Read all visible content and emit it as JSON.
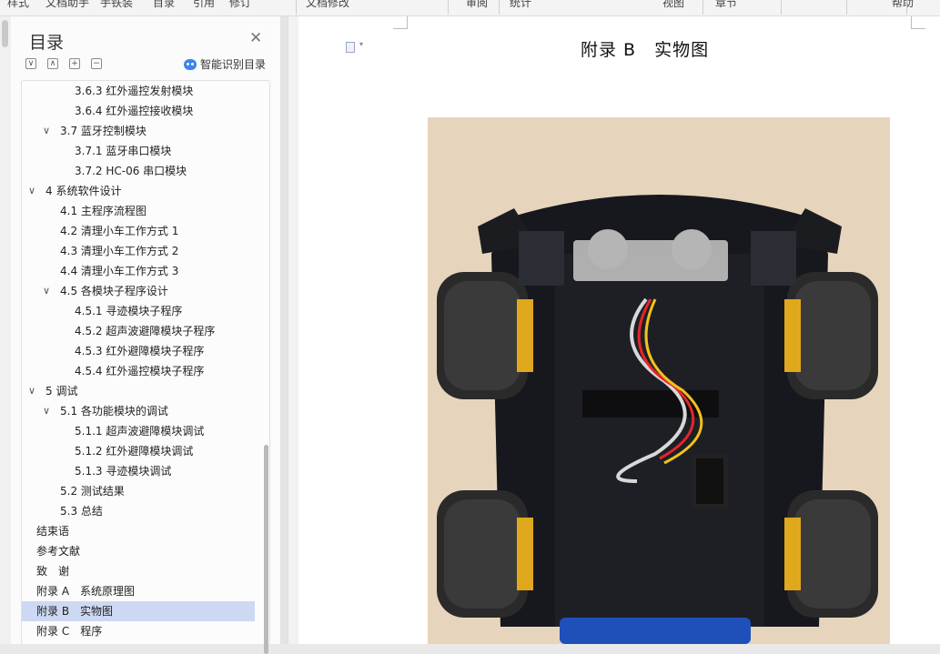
{
  "toolbar": {
    "items": [
      "样式",
      "文档助手",
      "手铁装",
      "目录",
      "引用",
      "修订",
      "文档修改",
      "审阅",
      "统计",
      "视图",
      "章节",
      "帮助"
    ]
  },
  "toc": {
    "title": "目录",
    "smart_button_label": "智能识别目录",
    "items": [
      {
        "label": "3.6.3 红外遥控发射模块",
        "level": 3,
        "caret": ""
      },
      {
        "label": "3.6.4 红外遥控接收模块",
        "level": 3,
        "caret": ""
      },
      {
        "label": "3.7 蓝牙控制模块",
        "level": 2,
        "caret": "∨"
      },
      {
        "label": "3.7.1 蓝牙串口模块",
        "level": 3,
        "caret": ""
      },
      {
        "label": "3.7.2 HC-06 串口模块",
        "level": 3,
        "caret": ""
      },
      {
        "label": "4 系统软件设计",
        "level": 1,
        "caret": "∨"
      },
      {
        "label": "4.1 主程序流程图",
        "level": 2,
        "caret": ""
      },
      {
        "label": "4.2 清理小车工作方式 1",
        "level": 2,
        "caret": ""
      },
      {
        "label": "4.3 清理小车工作方式 2",
        "level": 2,
        "caret": ""
      },
      {
        "label": "4.4 清理小车工作方式 3",
        "level": 2,
        "caret": ""
      },
      {
        "label": "4.5 各模块子程序设计",
        "level": 2,
        "caret": "∨"
      },
      {
        "label": "4.5.1 寻迹模块子程序",
        "level": 3,
        "caret": ""
      },
      {
        "label": "4.5.2 超声波避障模块子程序",
        "level": 3,
        "caret": ""
      },
      {
        "label": "4.5.3 红外避障模块子程序",
        "level": 3,
        "caret": ""
      },
      {
        "label": "4.5.4 红外遥控模块子程序",
        "level": 3,
        "caret": ""
      },
      {
        "label": "5 调试",
        "level": 1,
        "caret": "∨"
      },
      {
        "label": "5.1 各功能模块的调试",
        "level": 2,
        "caret": "∨"
      },
      {
        "label": "5.1.1 超声波避障模块调试",
        "level": 3,
        "caret": ""
      },
      {
        "label": "5.1.2 红外避障模块调试",
        "level": 3,
        "caret": ""
      },
      {
        "label": "5.1.3 寻迹模块调试",
        "level": 3,
        "caret": ""
      },
      {
        "label": "5.2 测试结果",
        "level": 2,
        "caret": ""
      },
      {
        "label": "5.3 总结",
        "level": 2,
        "caret": ""
      },
      {
        "label": "结束语",
        "level": 0,
        "caret": ""
      },
      {
        "label": "参考文献",
        "level": 0,
        "caret": ""
      },
      {
        "label": "致　谢",
        "level": 0,
        "caret": ""
      },
      {
        "label": "附录 A　系统原理图",
        "level": 0,
        "caret": ""
      },
      {
        "label": "附录 B　实物图",
        "level": 0,
        "caret": "",
        "active": true
      },
      {
        "label": "附录 C　程序",
        "level": 0,
        "caret": ""
      }
    ]
  },
  "document": {
    "heading": "附录 B　实物图"
  },
  "colors": {
    "active_row": "#cdd8f2",
    "accent": "#3a86e8"
  }
}
